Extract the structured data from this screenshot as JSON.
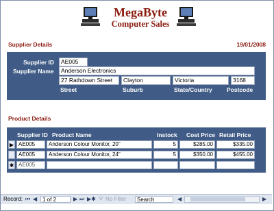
{
  "header": {
    "brand_name": "MegaByte",
    "brand_sub": "Computer Sales",
    "left_icon": "computer-icon",
    "right_icon": "computer-icon"
  },
  "supplier": {
    "section_title": "Supplier Details",
    "date": "19/01/2008",
    "id_label": "Supplier ID",
    "id_value": "AE005",
    "name_label": "Supplier Name",
    "name_value": "Anderson Electronics",
    "street_value": "27 Rathdown Street",
    "suburb_value": "Clayton",
    "state_value": "Victoria",
    "postcode_value": "3168",
    "street_label": "Street",
    "suburb_label": "Suburb",
    "state_label": "State/Country",
    "postcode_label": "Postcode"
  },
  "products": {
    "section_title": "Product Details",
    "columns": [
      "Supplier ID",
      "Product Name",
      "Instock",
      "Cost Price",
      "Retail Price"
    ],
    "rows": [
      {
        "selector": "▶",
        "supplier_id": "AE005",
        "product_name": "Anderson Colour Monitor, 20\"",
        "instock": "5",
        "cost": "$285.00",
        "retail": "$335.00"
      },
      {
        "selector": "",
        "supplier_id": "AE005",
        "product_name": "Anderson Colour Monitor, 24\"",
        "instock": "5",
        "cost": "$350.00",
        "retail": "$455.00"
      },
      {
        "selector": "✱",
        "supplier_id": "AE005",
        "product_name": "",
        "instock": "",
        "cost": "",
        "retail": ""
      }
    ]
  },
  "navigation": {
    "record_label": "Record:",
    "first": "⏮",
    "prev": "◀",
    "position": "1 of 2",
    "next": "▶",
    "last": "⏭",
    "new": "▶✱",
    "filter_label": "No Filter",
    "search_label": "Search"
  }
}
